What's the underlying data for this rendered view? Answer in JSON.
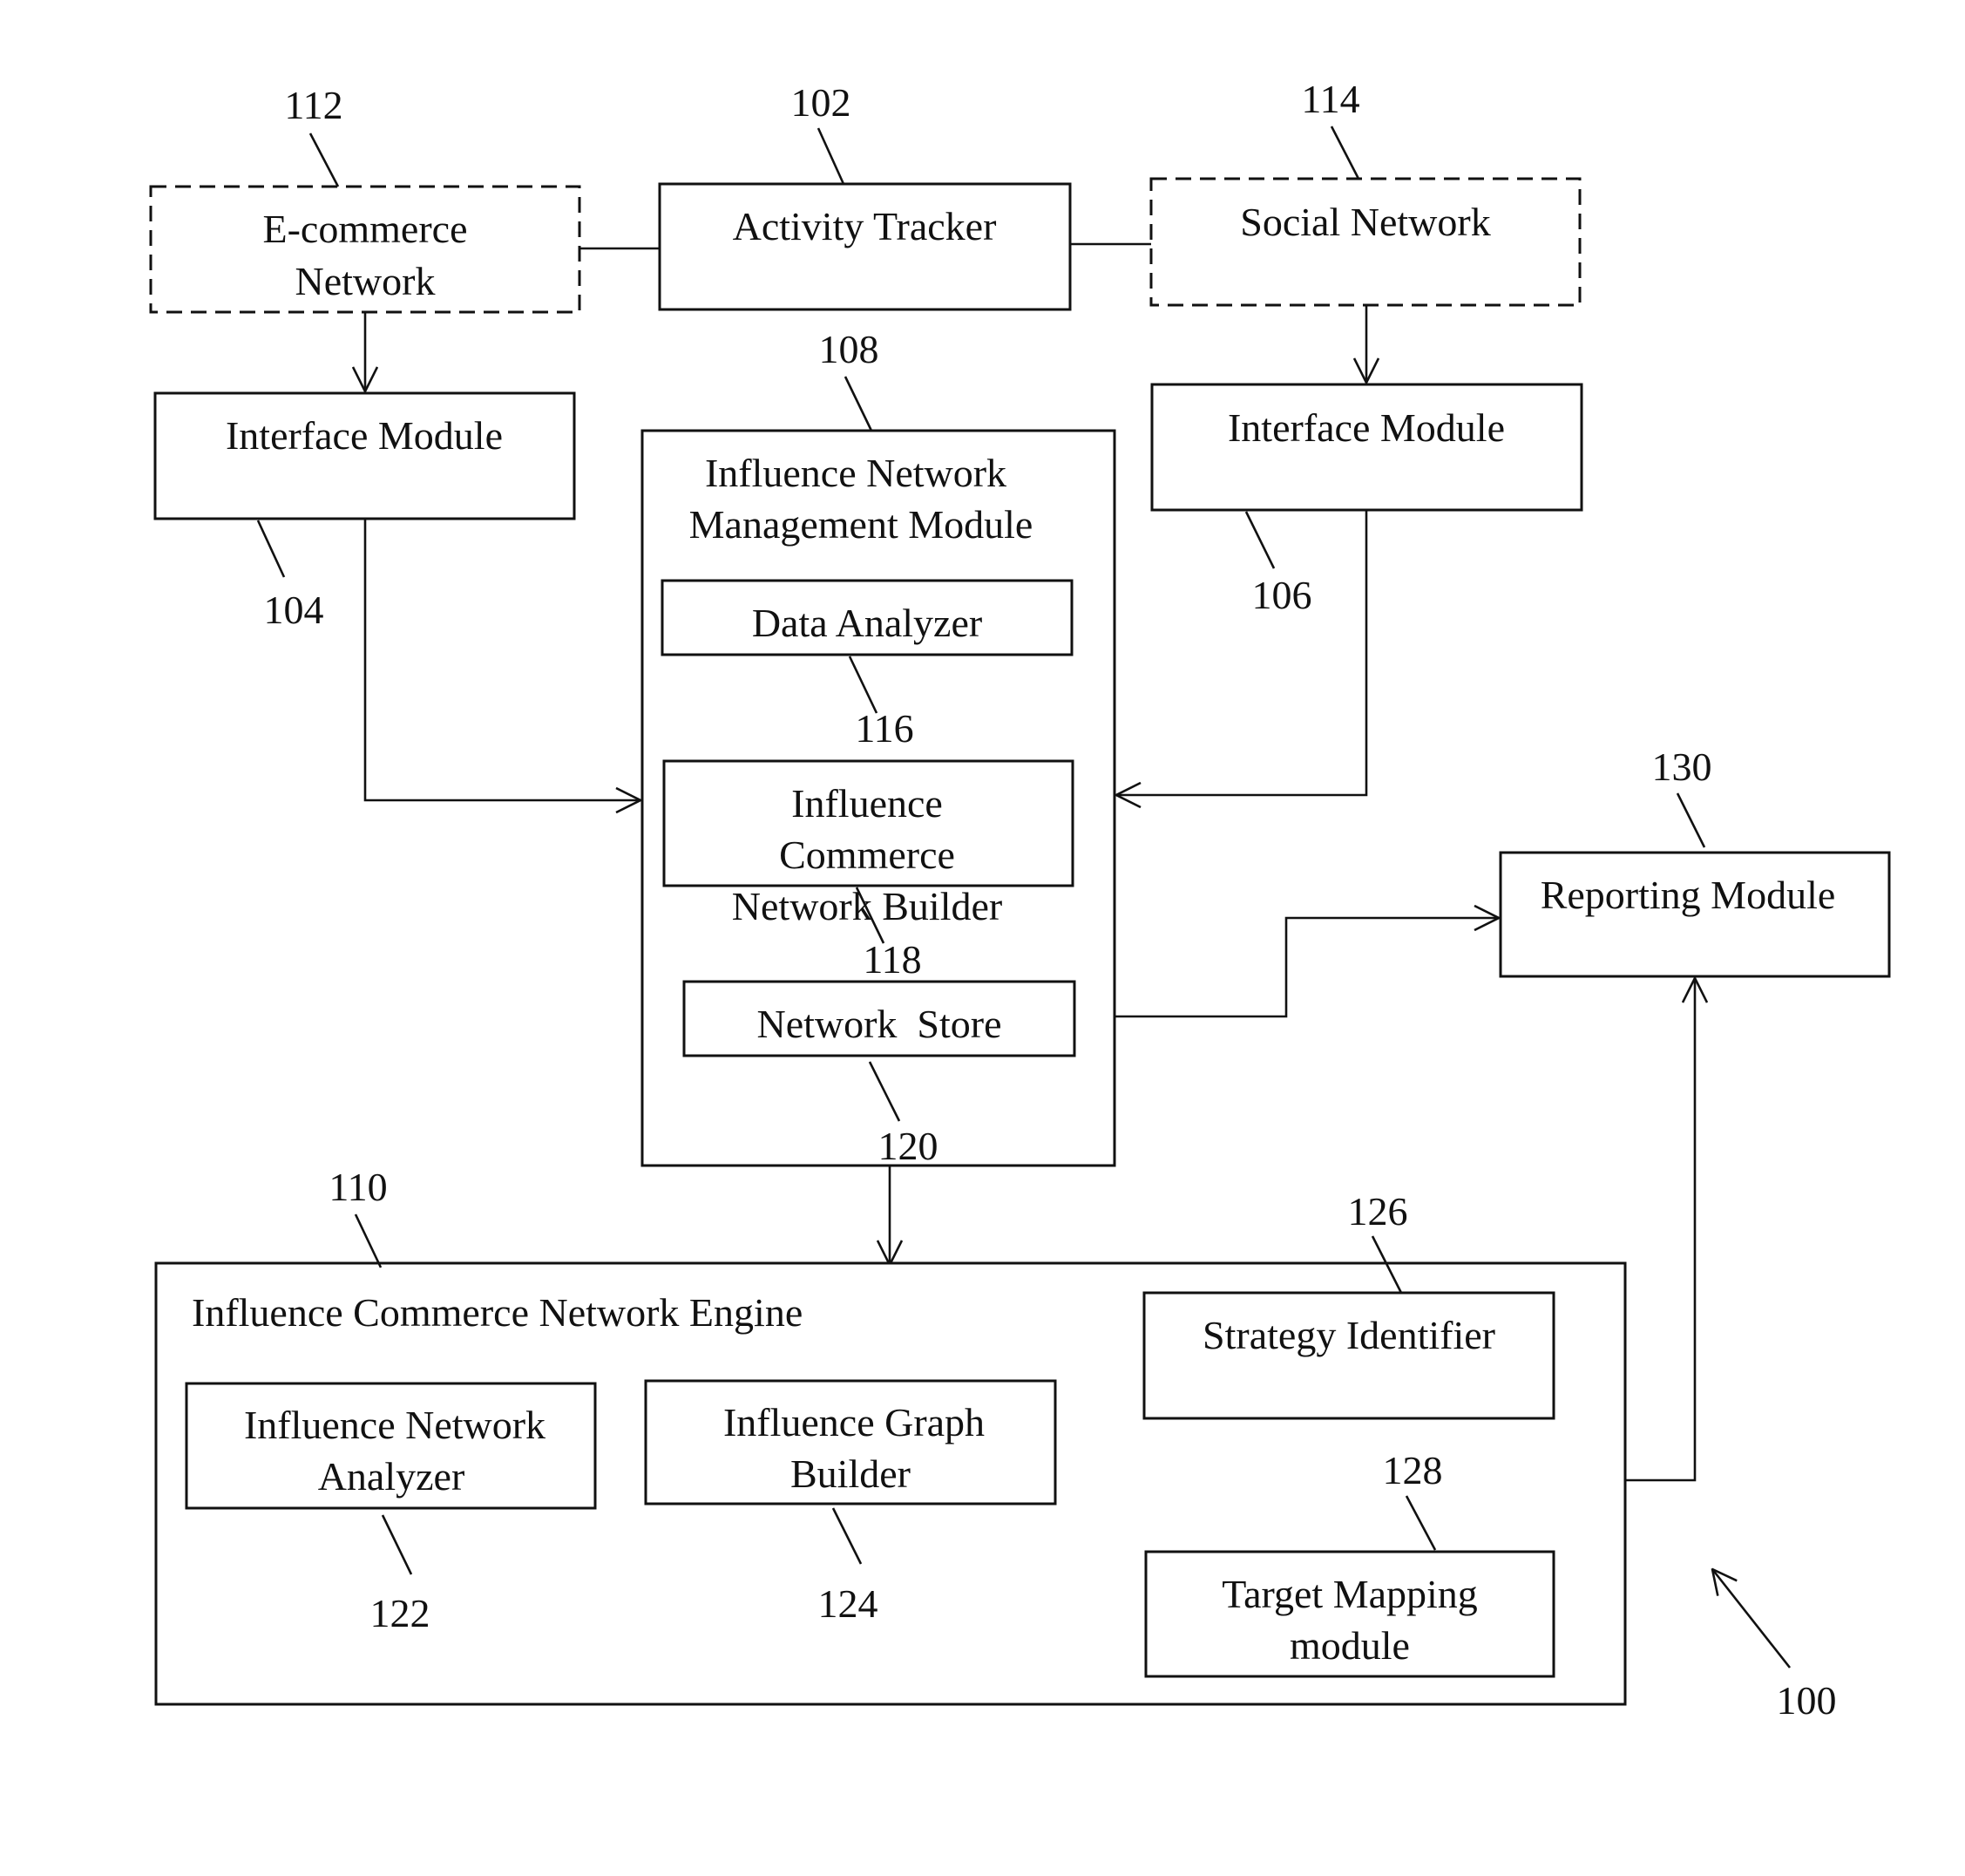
{
  "figure": {
    "system_ref": "100",
    "blocks": {
      "ecommerce": {
        "ref": "112",
        "lines": [
          "E-commerce",
          "Network"
        ],
        "style": "dashed"
      },
      "activity_tracker": {
        "ref": "102",
        "lines": [
          "Activity Tracker"
        ]
      },
      "social_network": {
        "ref": "114",
        "lines": [
          "Social Network"
        ],
        "style": "dashed"
      },
      "interface_left": {
        "ref": "104",
        "lines": [
          "Interface Module"
        ]
      },
      "interface_right": {
        "ref": "106",
        "lines": [
          "Interface Module"
        ]
      },
      "inmm": {
        "ref": "108",
        "lines": [
          "Influence Network",
          "Management Module"
        ]
      },
      "data_analyzer": {
        "ref": "116",
        "lines": [
          "Data Analyzer"
        ]
      },
      "icnb": {
        "ref": "118",
        "lines": [
          "Influence",
          "Commerce",
          "Network Builder"
        ]
      },
      "network_store": {
        "ref": "120",
        "lines": [
          "Network  Store"
        ]
      },
      "reporting": {
        "ref": "130",
        "lines": [
          "Reporting Module"
        ]
      },
      "engine": {
        "ref": "110",
        "lines": [
          "Influence Commerce Network Engine"
        ]
      },
      "ina": {
        "ref": "122",
        "lines": [
          "Influence Network",
          "Analyzer"
        ]
      },
      "igb": {
        "ref": "124",
        "lines": [
          "Influence Graph",
          "Builder"
        ]
      },
      "strategy": {
        "ref": "126",
        "lines": [
          "Strategy Identifier"
        ]
      },
      "target": {
        "ref": "128",
        "lines": [
          "Target Mapping",
          "module"
        ]
      }
    }
  }
}
